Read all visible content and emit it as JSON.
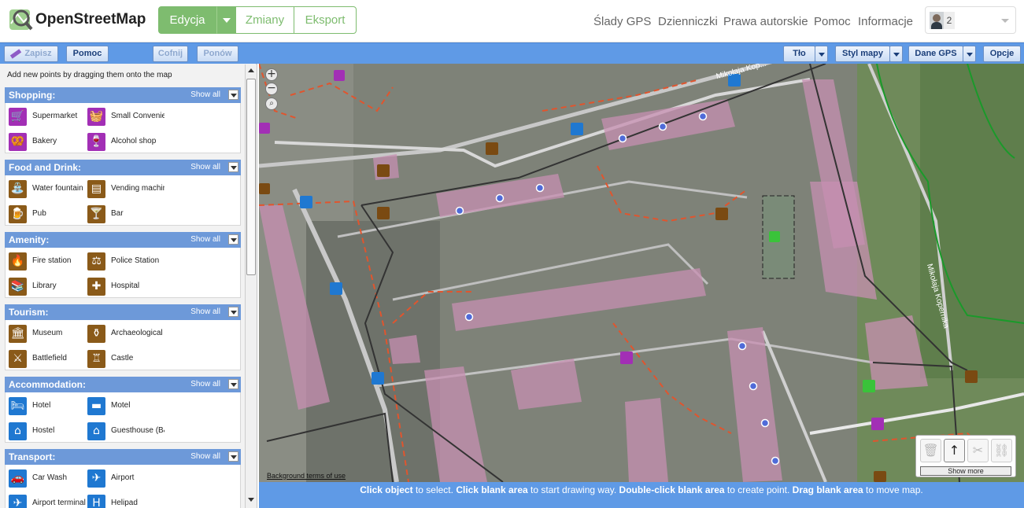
{
  "header": {
    "brand": "OpenStreetMap",
    "edit_label": "Edycja",
    "changes_label": "Zmiany",
    "export_label": "Eksport",
    "nav": [
      "Ślady GPS",
      "Dzienniczki",
      "Prawa autorskie",
      "Pomoc",
      "Informacje"
    ],
    "user_count": "2",
    "colors": {
      "accent": "#7ebc6f"
    }
  },
  "toolbar": {
    "save": "Zapisz",
    "help": "Pomoc",
    "undo": "Cofnij",
    "redo": "Ponów",
    "background": "Tło",
    "map_style": "Styl mapy",
    "gps_data": "Dane GPS",
    "options": "Opcje",
    "colors": {
      "bar": "#5f9ae6"
    }
  },
  "sidebar": {
    "hint": "Add new points by dragging them onto the map",
    "show_all": "Show all",
    "sections": [
      {
        "title": "Shopping:",
        "items": [
          {
            "label": "Supermarket",
            "icon": "shopping-cart-icon",
            "glyph": "🛒",
            "tone": "pur"
          },
          {
            "label": "Small Convenience",
            "icon": "basket-icon",
            "glyph": "🧺",
            "tone": "pur"
          },
          {
            "label": "Bakery",
            "icon": "pretzel-icon",
            "glyph": "🥨",
            "tone": "pur"
          },
          {
            "label": "Alcohol shop",
            "icon": "bottle-icon",
            "glyph": "🍷",
            "tone": "pur"
          }
        ]
      },
      {
        "title": "Food and Drink:",
        "items": [
          {
            "label": "Water fountain",
            "icon": "water-fountain-icon",
            "glyph": "⛲",
            "tone": "brn"
          },
          {
            "label": "Vending machine",
            "icon": "vending-machine-icon",
            "glyph": "▤",
            "tone": "brn"
          },
          {
            "label": "Pub",
            "icon": "pub-glass-icon",
            "glyph": "🍺",
            "tone": "brn"
          },
          {
            "label": "Bar",
            "icon": "cocktail-icon",
            "glyph": "🍸",
            "tone": "brn"
          }
        ]
      },
      {
        "title": "Amenity:",
        "items": [
          {
            "label": "Fire station",
            "icon": "fire-station-icon",
            "glyph": "🔥",
            "tone": "brn"
          },
          {
            "label": "Police Station",
            "icon": "police-icon",
            "glyph": "⚖",
            "tone": "brn"
          },
          {
            "label": "Library",
            "icon": "library-icon",
            "glyph": "📚",
            "tone": "brn"
          },
          {
            "label": "Hospital",
            "icon": "hospital-icon",
            "glyph": "✚",
            "tone": "brn"
          }
        ]
      },
      {
        "title": "Tourism:",
        "items": [
          {
            "label": "Museum",
            "icon": "museum-icon",
            "glyph": "🏛",
            "tone": "brn"
          },
          {
            "label": "Archaeological site",
            "icon": "amphora-icon",
            "glyph": "⚱",
            "tone": "brn"
          },
          {
            "label": "Battlefield",
            "icon": "battlefield-icon",
            "glyph": "⚔",
            "tone": "brn"
          },
          {
            "label": "Castle",
            "icon": "castle-icon",
            "glyph": "♖",
            "tone": "brn"
          }
        ]
      },
      {
        "title": "Accommodation:",
        "items": [
          {
            "label": "Hotel",
            "icon": "hotel-icon",
            "glyph": "🛏",
            "tone": "blu"
          },
          {
            "label": "Motel",
            "icon": "motel-icon",
            "glyph": "▬",
            "tone": "blu"
          },
          {
            "label": "Hostel",
            "icon": "hostel-icon",
            "glyph": "⌂",
            "tone": "blu"
          },
          {
            "label": "Guesthouse (B&B)",
            "icon": "guesthouse-icon",
            "glyph": "⌂",
            "tone": "blu"
          }
        ]
      },
      {
        "title": "Transport:",
        "items": [
          {
            "label": "Car Wash",
            "icon": "car-wash-icon",
            "glyph": "🚗",
            "tone": "blu"
          },
          {
            "label": "Airport",
            "icon": "airplane-icon",
            "glyph": "✈",
            "tone": "blu"
          },
          {
            "label": "Airport terminal",
            "icon": "airport-terminal-icon",
            "glyph": "✈",
            "tone": "blu"
          },
          {
            "label": "Helipad",
            "icon": "helipad-icon",
            "glyph": "H",
            "tone": "blu"
          }
        ]
      }
    ]
  },
  "map": {
    "zoom_in": "+",
    "zoom_out": "−",
    "street_top": "Mikołaja Kop...",
    "street_right": "Mikołaja Kopernika",
    "terms": "Background terms of use",
    "show_more": "Show more"
  },
  "status": {
    "s1": "Click object",
    "t1": " to select. ",
    "s2": "Click blank area",
    "t2": " to start drawing way. ",
    "s3": "Double-click blank area",
    "t3": " to create point. ",
    "s4": "Drag blank area",
    "t4": " to move map."
  }
}
